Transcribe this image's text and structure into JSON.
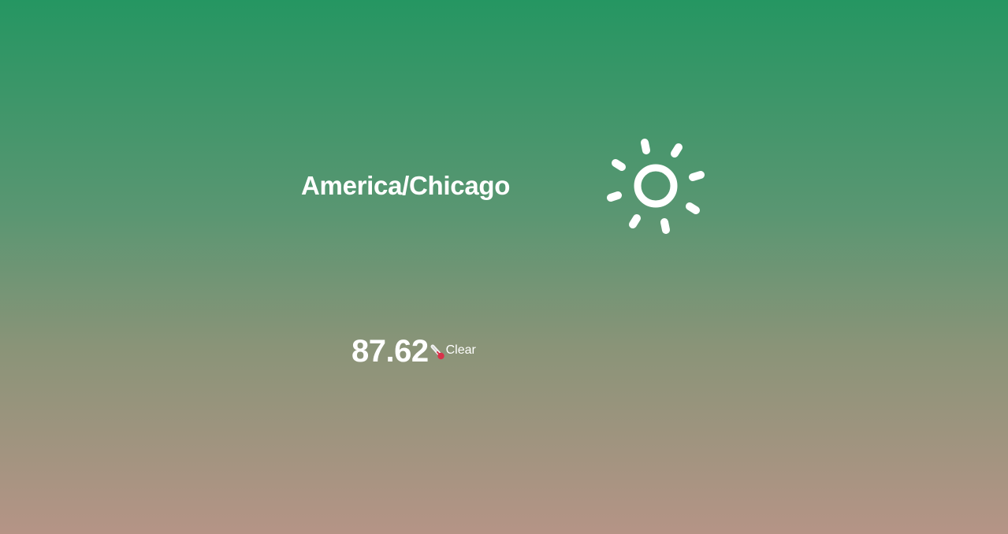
{
  "weather": {
    "location": "America/Chicago",
    "temperature": "87.62",
    "condition": "Clear",
    "condition_icon": "sun-icon",
    "temperature_icon": "thermometer-icon"
  },
  "colors": {
    "gradient_top": "#259662",
    "gradient_bottom": "#b59486",
    "text": "#ffffff",
    "thermometer_bulb": "#d8324a"
  }
}
